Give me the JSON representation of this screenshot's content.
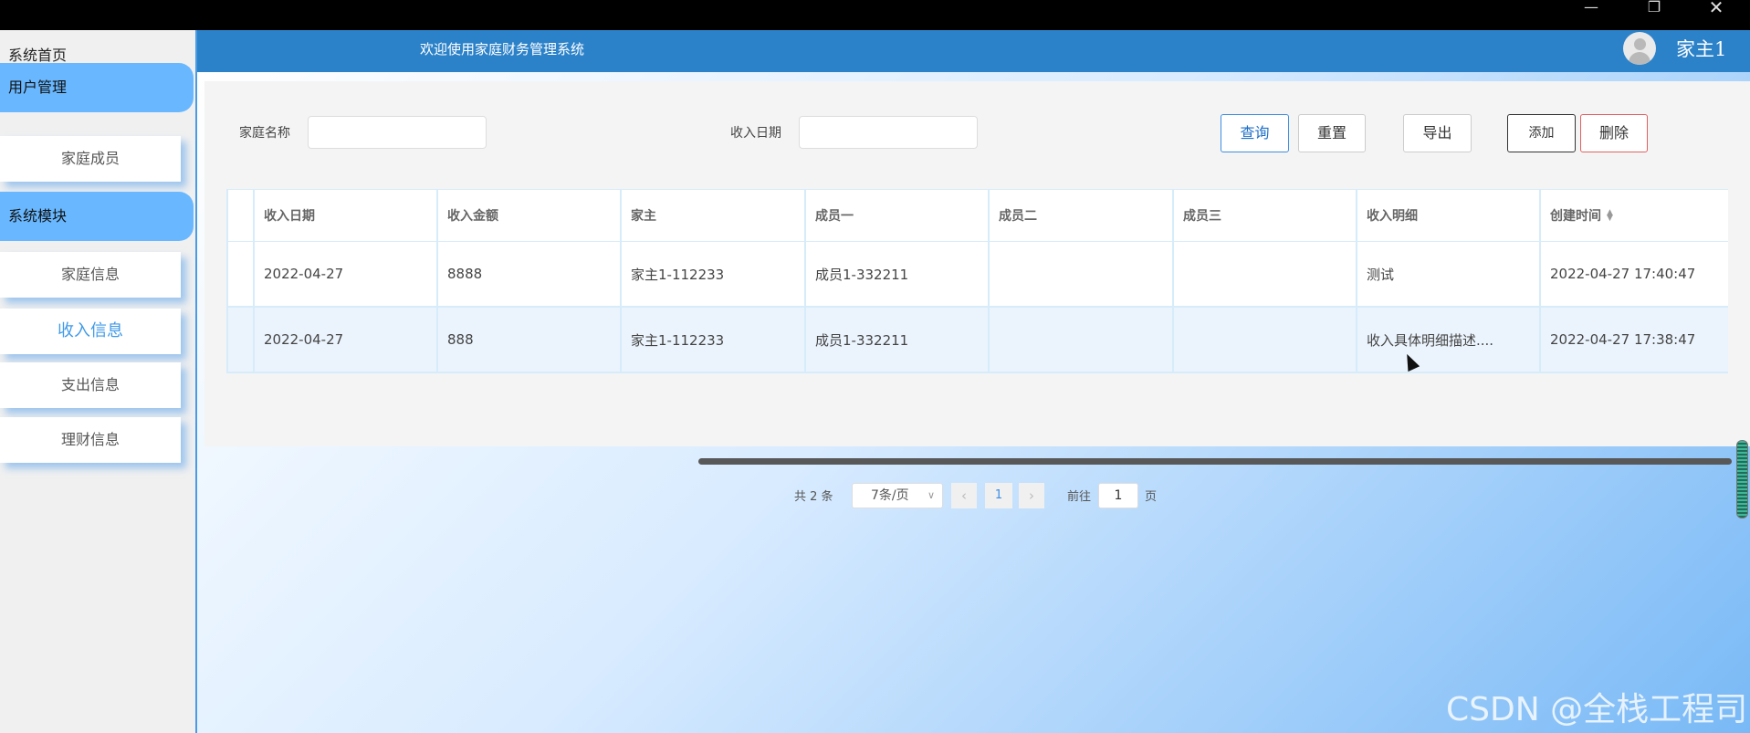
{
  "window": {
    "minimize": "—",
    "maximize": "❐",
    "close": "✕"
  },
  "header": {
    "welcome": "欢迎使用家庭财务管理系统",
    "username": "家主1"
  },
  "sidebar": {
    "home": "系统首页",
    "groups": [
      {
        "label": "用户管理",
        "items": [
          {
            "label": "家庭成员"
          }
        ]
      },
      {
        "label": "系统模块",
        "items": [
          {
            "label": "家庭信息"
          },
          {
            "label": "收入信息"
          },
          {
            "label": "支出信息"
          },
          {
            "label": "理财信息"
          }
        ]
      }
    ],
    "active_item": "收入信息"
  },
  "search": {
    "family_name_label": "家庭名称",
    "family_name_value": "",
    "income_date_label": "收入日期",
    "income_date_value": ""
  },
  "toolbar": {
    "query": "查询",
    "reset": "重置",
    "export": "导出",
    "add": "添加",
    "delete": "删除"
  },
  "table": {
    "columns": [
      "收入日期",
      "收入金额",
      "家主",
      "成员一",
      "成员二",
      "成员三",
      "收入明细",
      "创建时间"
    ],
    "rows": [
      [
        "2022-04-27",
        "8888",
        "家主1-112233",
        "成员1-332211",
        "",
        "",
        "测试",
        "2022-04-27 17:40:47"
      ],
      [
        "2022-04-27",
        "888",
        "家主1-112233",
        "成员1-332211",
        "",
        "",
        "收入具体明细描述....",
        "2022-04-27 17:38:47"
      ]
    ]
  },
  "pagination": {
    "total_prefix": "共 2 条",
    "page_size": "7条/页",
    "current_page": "1",
    "goto_label": "前往",
    "goto_value": "1",
    "goto_suffix": "页",
    "prev": "‹",
    "next": "›"
  },
  "watermark": "CSDN @全栈工程司",
  "colors": {
    "header": "#2c82c9",
    "sidebar_group": "#69b8ff",
    "accent": "#3f9ae8",
    "delete": "#e06060"
  }
}
